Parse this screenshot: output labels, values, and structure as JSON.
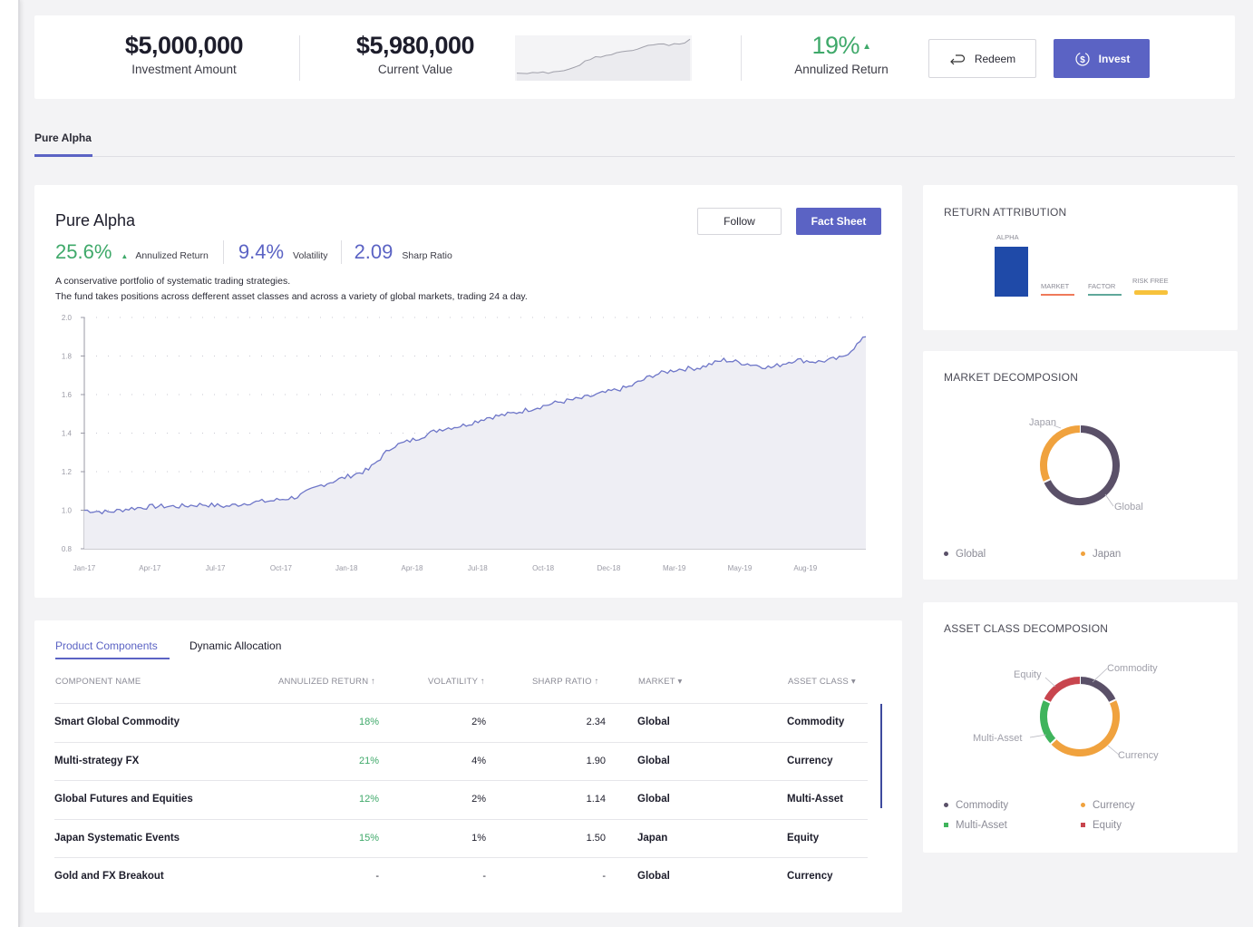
{
  "header": {
    "investment_amount": "$5,000,000",
    "investment_label": "Investment Amount",
    "current_value": "$5,980,000",
    "current_label": "Current Value",
    "annualized_return": "19%",
    "annualized_label": "Annulized Return",
    "redeem_label": "Redeem",
    "invest_label": "Invest"
  },
  "tabs": {
    "active": "Pure Alpha"
  },
  "fund": {
    "name": "Pure Alpha",
    "follow_label": "Follow",
    "factsheet_label": "Fact Sheet",
    "annualized_return": "25.6%",
    "annualized_return_label": "Annulized Return",
    "volatility": "9.4%",
    "volatility_label": "Volatility",
    "sharp_ratio": "2.09",
    "sharp_ratio_label": "Sharp Ratio",
    "desc_line1": "A conservative portfolio of systematic trading strategies.",
    "desc_line2": "The fund takes positions across defferent asset classes and across a variety of global markets, trading 24 a day."
  },
  "chart_data": {
    "type": "area",
    "x_ticks": [
      "Jan-17",
      "Apr-17",
      "Jul-17",
      "Oct-17",
      "Jan-18",
      "Apr-18",
      "Jul-18",
      "Oct-18",
      "Dec-18",
      "Mar-19",
      "May-19",
      "Aug-19"
    ],
    "y_ticks": [
      "2.0",
      "1.8",
      "1.6",
      "1.4",
      "1.2",
      "1.0",
      "0.8"
    ],
    "ylim": [
      0.8,
      2.0
    ],
    "grid": true,
    "series": [
      {
        "values": [
          {
            "x": "Jan-17",
            "y": 1.0
          },
          {
            "x": "Feb-17",
            "y": 0.99
          },
          {
            "x": "Mar-17",
            "y": 1.01
          },
          {
            "x": "Apr-17",
            "y": 1.02
          },
          {
            "x": "May-17",
            "y": 1.02
          },
          {
            "x": "Jun-17",
            "y": 1.03
          },
          {
            "x": "Jul-17",
            "y": 1.02
          },
          {
            "x": "Aug-17",
            "y": 1.04
          },
          {
            "x": "Sep-17",
            "y": 1.05
          },
          {
            "x": "Oct-17",
            "y": 1.07
          },
          {
            "x": "Nov-17",
            "y": 1.13
          },
          {
            "x": "Dec-17",
            "y": 1.17
          },
          {
            "x": "Jan-18",
            "y": 1.21
          },
          {
            "x": "Feb-18",
            "y": 1.33
          },
          {
            "x": "Mar-18",
            "y": 1.37
          },
          {
            "x": "Apr-18",
            "y": 1.42
          },
          {
            "x": "May-18",
            "y": 1.44
          },
          {
            "x": "Jun-18",
            "y": 1.48
          },
          {
            "x": "Jul-18",
            "y": 1.5
          },
          {
            "x": "Aug-18",
            "y": 1.53
          },
          {
            "x": "Sep-18",
            "y": 1.56
          },
          {
            "x": "Oct-18",
            "y": 1.58
          },
          {
            "x": "Nov-18",
            "y": 1.61
          },
          {
            "x": "Dec-18",
            "y": 1.64
          },
          {
            "x": "Jan-19",
            "y": 1.7
          },
          {
            "x": "Feb-19",
            "y": 1.73
          },
          {
            "x": "Mar-19",
            "y": 1.74
          },
          {
            "x": "Apr-19",
            "y": 1.78
          },
          {
            "x": "May-19",
            "y": 1.76
          },
          {
            "x": "Jun-19",
            "y": 1.74
          },
          {
            "x": "Jul-19",
            "y": 1.78
          },
          {
            "x": "Aug-19",
            "y": 1.77
          },
          {
            "x": "Sep-19",
            "y": 1.79
          },
          {
            "x": "Oct-19",
            "y": 1.9
          }
        ]
      }
    ]
  },
  "components": {
    "tab_active": "Product Components",
    "tab_other": "Dynamic Allocation",
    "headers": {
      "name": "COMPONENT NAME",
      "ret": "ANNULIZED RETURN",
      "vol": "VOLATILITY",
      "sharp": "SHARP RATIO",
      "market": "MARKET",
      "asset": "ASSET CLASS"
    },
    "rows": [
      {
        "name": "Smart Global Commodity",
        "ret": "18%",
        "vol": "2%",
        "sharp": "2.34",
        "market": "Global",
        "asset": "Commodity"
      },
      {
        "name": "Multi-strategy FX",
        "ret": "21%",
        "vol": "4%",
        "sharp": "1.90",
        "market": "Global",
        "asset": "Currency"
      },
      {
        "name": "Global Futures and Equities",
        "ret": "12%",
        "vol": "2%",
        "sharp": "1.14",
        "market": "Global",
        "asset": "Multi-Asset"
      },
      {
        "name": "Japan Systematic Events",
        "ret": "15%",
        "vol": "1%",
        "sharp": "1.50",
        "market": "Japan",
        "asset": "Equity"
      },
      {
        "name": "Gold and FX Breakout",
        "ret": "-",
        "vol": "-",
        "sharp": "-",
        "market": "Global",
        "asset": "Currency"
      }
    ]
  },
  "return_attribution": {
    "title": "RETURN ATTRIBUTION",
    "labels": [
      "ALPHA",
      "MARKET",
      "FACTOR",
      "RISK FREE"
    ],
    "colors": [
      "#1f4aa8",
      "#ef7a5a",
      "#5fa89a",
      "#f7c23c"
    ],
    "alpha_level": 1.0
  },
  "market_decomposition": {
    "title": "MARKET DECOMPOSION",
    "slices": [
      {
        "label": "Global",
        "value": 0.68,
        "color": "#5a5068"
      },
      {
        "label": "Japan",
        "value": 0.32,
        "color": "#f0a23e"
      }
    ]
  },
  "asset_decomposition": {
    "title": "ASSET CLASS DECOMPOSION",
    "slices": [
      {
        "label": "Commodity",
        "value": 0.18,
        "color": "#5a5068"
      },
      {
        "label": "Currency",
        "value": 0.45,
        "color": "#f0a23e"
      },
      {
        "label": "Multi-Asset",
        "value": 0.19,
        "color": "#3fb45c"
      },
      {
        "label": "Equity",
        "value": 0.18,
        "color": "#c8454e"
      }
    ]
  },
  "colors": {
    "accent": "#5b63c4",
    "positive": "#3fa96a",
    "line": "#6e76c8"
  }
}
